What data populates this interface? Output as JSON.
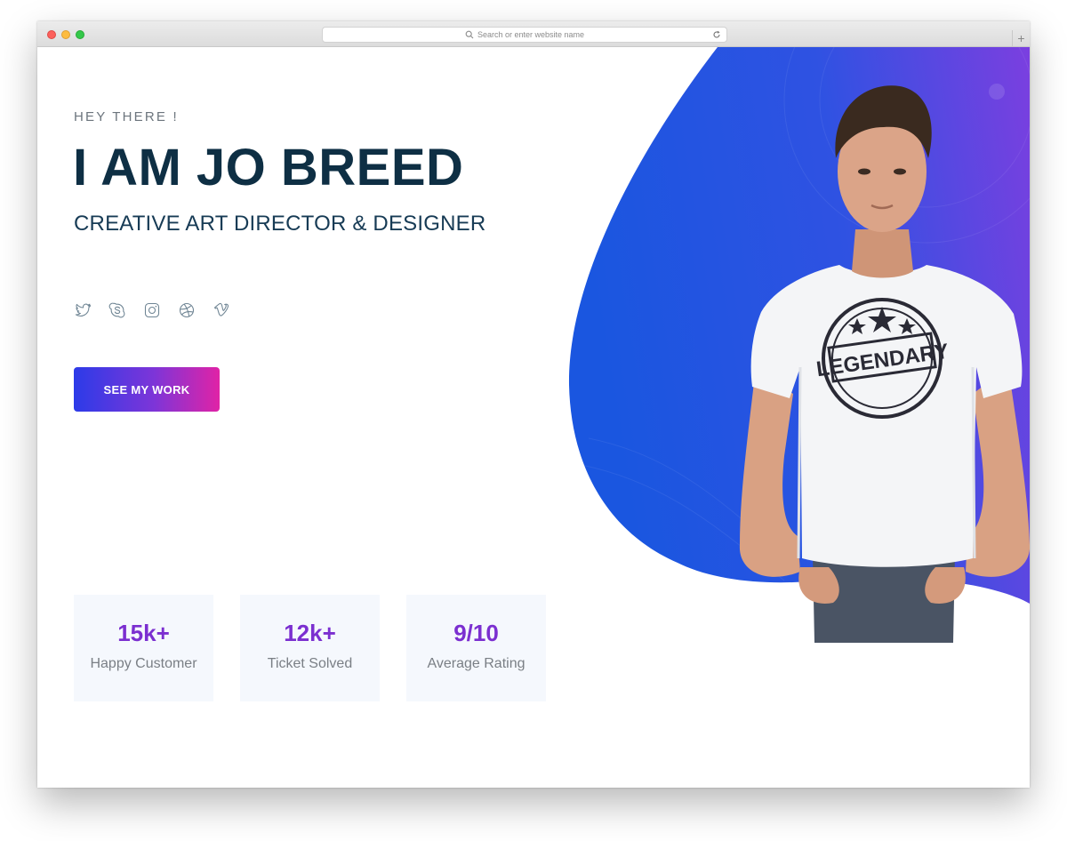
{
  "browser": {
    "address_placeholder": "Search or enter website name",
    "new_tab": "+"
  },
  "hero": {
    "greeting": "HEY THERE !",
    "name": "I AM JO BREED",
    "role": "CREATIVE ART DIRECTOR & DESIGNER",
    "cta_label": "SEE MY WORK",
    "socials": [
      "twitter-icon",
      "skype-icon",
      "instagram-icon",
      "dribbble-icon",
      "vimeo-icon"
    ],
    "accent_gradient": [
      "#2c3be8",
      "#e023a6"
    ],
    "blob_colors": [
      "#1a56e0",
      "#7b3fe0"
    ],
    "shirt_print": "LEGENDARY"
  },
  "stats": [
    {
      "value": "15k+",
      "label": "Happy Customer"
    },
    {
      "value": "12k+",
      "label": "Ticket Solved"
    },
    {
      "value": "9/10",
      "label": "Average Rating"
    }
  ]
}
